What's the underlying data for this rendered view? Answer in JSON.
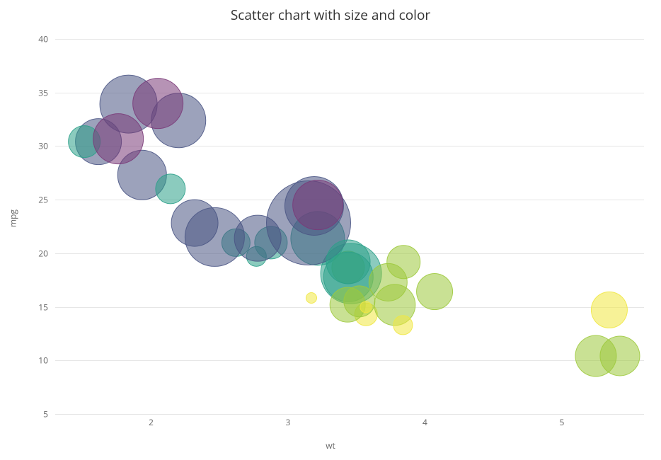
{
  "chart_data": {
    "type": "scatter",
    "title": "Scatter chart with size and color",
    "xlabel": "wt",
    "ylabel": "mpg",
    "xlim": [
      1.3,
      5.6
    ],
    "ylim": [
      5,
      40
    ],
    "xticks": [
      2,
      3,
      4,
      5
    ],
    "yticks": [
      5,
      10,
      15,
      20,
      25,
      30,
      35,
      40
    ],
    "series": [
      {
        "x": 2.62,
        "y": 21.0,
        "size": 16.46,
        "color": "#2ca089"
      },
      {
        "x": 2.875,
        "y": 21.0,
        "size": 17.02,
        "color": "#2ca089"
      },
      {
        "x": 2.32,
        "y": 22.8,
        "size": 18.61,
        "color": "#4a5584"
      },
      {
        "x": 3.215,
        "y": 21.4,
        "size": 19.44,
        "color": "#2ca089"
      },
      {
        "x": 3.44,
        "y": 18.7,
        "size": 17.02,
        "color": "#9dc93c"
      },
      {
        "x": 3.46,
        "y": 18.1,
        "size": 20.22,
        "color": "#2ca089"
      },
      {
        "x": 3.57,
        "y": 14.3,
        "size": 15.84,
        "color": "#f0e742"
      },
      {
        "x": 3.19,
        "y": 24.4,
        "size": 20.0,
        "color": "#4a5584"
      },
      {
        "x": 3.15,
        "y": 22.8,
        "size": 22.9,
        "color": "#4a5584"
      },
      {
        "x": 3.44,
        "y": 19.2,
        "size": 18.3,
        "color": "#2ca089"
      },
      {
        "x": 3.44,
        "y": 17.8,
        "size": 18.9,
        "color": "#2ca089"
      },
      {
        "x": 4.07,
        "y": 16.4,
        "size": 17.4,
        "color": "#9dc93c"
      },
      {
        "x": 3.73,
        "y": 17.3,
        "size": 17.6,
        "color": "#9dc93c"
      },
      {
        "x": 3.78,
        "y": 15.2,
        "size": 18.0,
        "color": "#9dc93c"
      },
      {
        "x": 5.25,
        "y": 10.4,
        "size": 17.98,
        "color": "#9dc93c"
      },
      {
        "x": 5.424,
        "y": 10.4,
        "size": 17.82,
        "color": "#9dc93c"
      },
      {
        "x": 5.345,
        "y": 14.7,
        "size": 17.42,
        "color": "#f0e742"
      },
      {
        "x": 2.2,
        "y": 32.4,
        "size": 19.47,
        "color": "#4a5584"
      },
      {
        "x": 1.615,
        "y": 30.4,
        "size": 18.52,
        "color": "#4a5584"
      },
      {
        "x": 1.835,
        "y": 33.9,
        "size": 19.9,
        "color": "#4a5584"
      },
      {
        "x": 2.465,
        "y": 21.5,
        "size": 20.01,
        "color": "#4a5584"
      },
      {
        "x": 3.52,
        "y": 15.5,
        "size": 16.87,
        "color": "#9dc93c"
      },
      {
        "x": 3.435,
        "y": 15.2,
        "size": 17.3,
        "color": "#9dc93c"
      },
      {
        "x": 3.84,
        "y": 13.3,
        "size": 15.41,
        "color": "#f0e742"
      },
      {
        "x": 3.845,
        "y": 19.2,
        "size": 17.05,
        "color": "#9dc93c"
      },
      {
        "x": 1.935,
        "y": 27.3,
        "size": 18.9,
        "color": "#4a5584"
      },
      {
        "x": 2.14,
        "y": 26.0,
        "size": 16.7,
        "color": "#2ca089"
      },
      {
        "x": 1.513,
        "y": 30.4,
        "size": 16.9,
        "color": "#2ca089"
      },
      {
        "x": 3.17,
        "y": 15.8,
        "size": 14.5,
        "color": "#f0e742"
      },
      {
        "x": 2.77,
        "y": 19.7,
        "size": 15.5,
        "color": "#2ca089"
      },
      {
        "x": 3.57,
        "y": 15.0,
        "size": 14.6,
        "color": "#f0e742"
      },
      {
        "x": 2.78,
        "y": 21.4,
        "size": 18.6,
        "color": "#4a5584"
      },
      {
        "x": 1.76,
        "y": 30.7,
        "size": 19.0,
        "color": "#7a3a78"
      },
      {
        "x": 3.22,
        "y": 24.5,
        "size": 19.0,
        "color": "#7a3a78"
      },
      {
        "x": 2.05,
        "y": 34.0,
        "size": 19.0,
        "color": "#7a3a78"
      }
    ],
    "sizeScale": {
      "min": 14.5,
      "max": 22.9,
      "minPx": 8,
      "maxPx": 60
    },
    "colors": {
      "purple": "#7a3a78",
      "darkblue": "#4a5584",
      "teal": "#2ca089",
      "green": "#9dc93c",
      "yellow": "#f0e742"
    }
  }
}
